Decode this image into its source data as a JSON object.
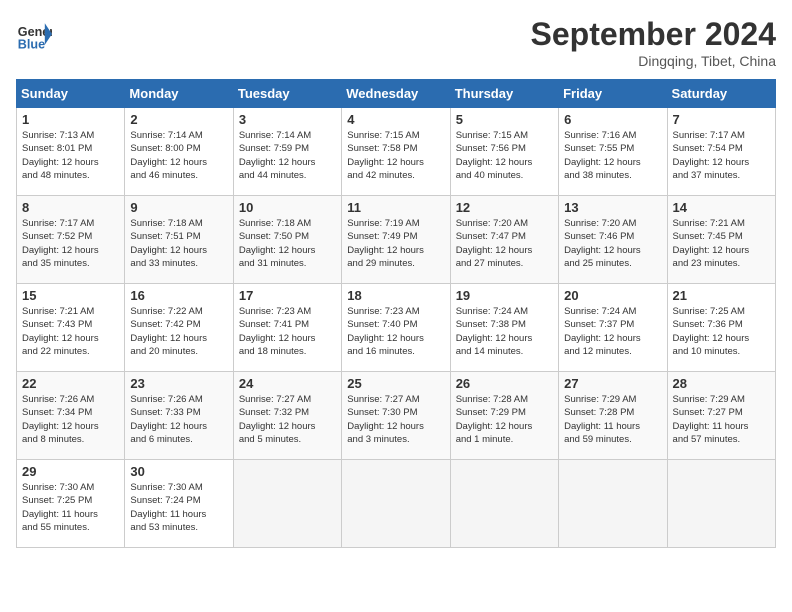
{
  "header": {
    "logo_line1": "General",
    "logo_line2": "Blue",
    "month": "September 2024",
    "location": "Dingqing, Tibet, China"
  },
  "weekdays": [
    "Sunday",
    "Monday",
    "Tuesday",
    "Wednesday",
    "Thursday",
    "Friday",
    "Saturday"
  ],
  "weeks": [
    [
      {
        "day": "1",
        "info": "Sunrise: 7:13 AM\nSunset: 8:01 PM\nDaylight: 12 hours\nand 48 minutes."
      },
      {
        "day": "2",
        "info": "Sunrise: 7:14 AM\nSunset: 8:00 PM\nDaylight: 12 hours\nand 46 minutes."
      },
      {
        "day": "3",
        "info": "Sunrise: 7:14 AM\nSunset: 7:59 PM\nDaylight: 12 hours\nand 44 minutes."
      },
      {
        "day": "4",
        "info": "Sunrise: 7:15 AM\nSunset: 7:58 PM\nDaylight: 12 hours\nand 42 minutes."
      },
      {
        "day": "5",
        "info": "Sunrise: 7:15 AM\nSunset: 7:56 PM\nDaylight: 12 hours\nand 40 minutes."
      },
      {
        "day": "6",
        "info": "Sunrise: 7:16 AM\nSunset: 7:55 PM\nDaylight: 12 hours\nand 38 minutes."
      },
      {
        "day": "7",
        "info": "Sunrise: 7:17 AM\nSunset: 7:54 PM\nDaylight: 12 hours\nand 37 minutes."
      }
    ],
    [
      {
        "day": "8",
        "info": "Sunrise: 7:17 AM\nSunset: 7:52 PM\nDaylight: 12 hours\nand 35 minutes."
      },
      {
        "day": "9",
        "info": "Sunrise: 7:18 AM\nSunset: 7:51 PM\nDaylight: 12 hours\nand 33 minutes."
      },
      {
        "day": "10",
        "info": "Sunrise: 7:18 AM\nSunset: 7:50 PM\nDaylight: 12 hours\nand 31 minutes."
      },
      {
        "day": "11",
        "info": "Sunrise: 7:19 AM\nSunset: 7:49 PM\nDaylight: 12 hours\nand 29 minutes."
      },
      {
        "day": "12",
        "info": "Sunrise: 7:20 AM\nSunset: 7:47 PM\nDaylight: 12 hours\nand 27 minutes."
      },
      {
        "day": "13",
        "info": "Sunrise: 7:20 AM\nSunset: 7:46 PM\nDaylight: 12 hours\nand 25 minutes."
      },
      {
        "day": "14",
        "info": "Sunrise: 7:21 AM\nSunset: 7:45 PM\nDaylight: 12 hours\nand 23 minutes."
      }
    ],
    [
      {
        "day": "15",
        "info": "Sunrise: 7:21 AM\nSunset: 7:43 PM\nDaylight: 12 hours\nand 22 minutes."
      },
      {
        "day": "16",
        "info": "Sunrise: 7:22 AM\nSunset: 7:42 PM\nDaylight: 12 hours\nand 20 minutes."
      },
      {
        "day": "17",
        "info": "Sunrise: 7:23 AM\nSunset: 7:41 PM\nDaylight: 12 hours\nand 18 minutes."
      },
      {
        "day": "18",
        "info": "Sunrise: 7:23 AM\nSunset: 7:40 PM\nDaylight: 12 hours\nand 16 minutes."
      },
      {
        "day": "19",
        "info": "Sunrise: 7:24 AM\nSunset: 7:38 PM\nDaylight: 12 hours\nand 14 minutes."
      },
      {
        "day": "20",
        "info": "Sunrise: 7:24 AM\nSunset: 7:37 PM\nDaylight: 12 hours\nand 12 minutes."
      },
      {
        "day": "21",
        "info": "Sunrise: 7:25 AM\nSunset: 7:36 PM\nDaylight: 12 hours\nand 10 minutes."
      }
    ],
    [
      {
        "day": "22",
        "info": "Sunrise: 7:26 AM\nSunset: 7:34 PM\nDaylight: 12 hours\nand 8 minutes."
      },
      {
        "day": "23",
        "info": "Sunrise: 7:26 AM\nSunset: 7:33 PM\nDaylight: 12 hours\nand 6 minutes."
      },
      {
        "day": "24",
        "info": "Sunrise: 7:27 AM\nSunset: 7:32 PM\nDaylight: 12 hours\nand 5 minutes."
      },
      {
        "day": "25",
        "info": "Sunrise: 7:27 AM\nSunset: 7:30 PM\nDaylight: 12 hours\nand 3 minutes."
      },
      {
        "day": "26",
        "info": "Sunrise: 7:28 AM\nSunset: 7:29 PM\nDaylight: 12 hours\nand 1 minute."
      },
      {
        "day": "27",
        "info": "Sunrise: 7:29 AM\nSunset: 7:28 PM\nDaylight: 11 hours\nand 59 minutes."
      },
      {
        "day": "28",
        "info": "Sunrise: 7:29 AM\nSunset: 7:27 PM\nDaylight: 11 hours\nand 57 minutes."
      }
    ],
    [
      {
        "day": "29",
        "info": "Sunrise: 7:30 AM\nSunset: 7:25 PM\nDaylight: 11 hours\nand 55 minutes."
      },
      {
        "day": "30",
        "info": "Sunrise: 7:30 AM\nSunset: 7:24 PM\nDaylight: 11 hours\nand 53 minutes."
      },
      {
        "day": "",
        "info": ""
      },
      {
        "day": "",
        "info": ""
      },
      {
        "day": "",
        "info": ""
      },
      {
        "day": "",
        "info": ""
      },
      {
        "day": "",
        "info": ""
      }
    ]
  ]
}
